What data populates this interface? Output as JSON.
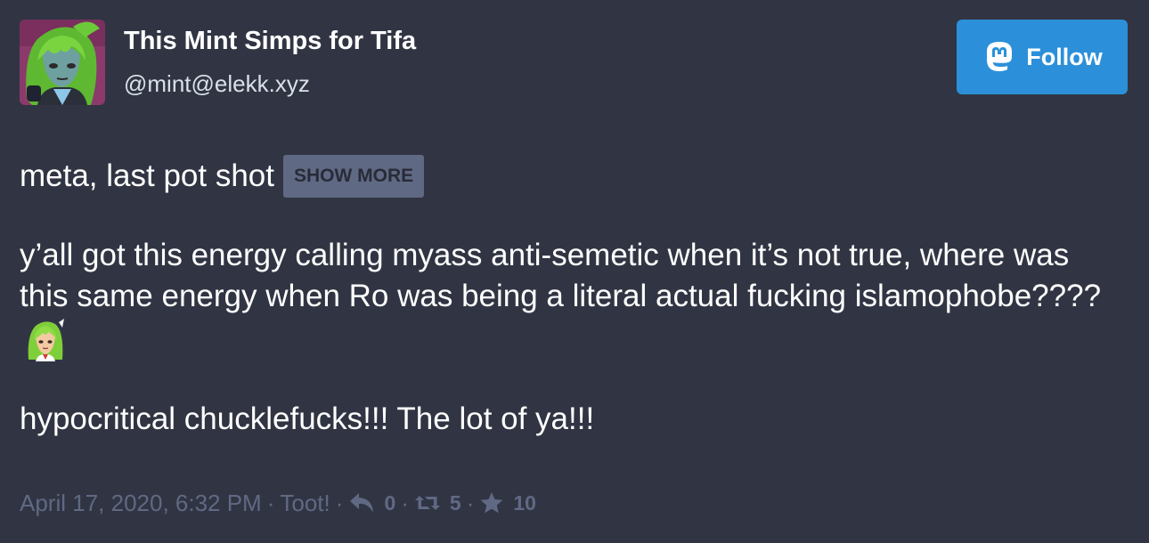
{
  "account": {
    "display_name": "This Mint Simps for Tifa",
    "handle": "@mint@elekk.xyz"
  },
  "follow_button": {
    "label": "Follow"
  },
  "status": {
    "content_warning": "meta, last pot shot",
    "show_more_label": "Show more",
    "paragraphs": [
      "y’all got this energy calling myass anti-semetic when it’s not true, where was this same energy when Ro was being a literal actual fucking islamophobe????",
      "hypocritical chucklefucks!!! The lot of ya!!!"
    ]
  },
  "meta": {
    "timestamp": "April 17, 2020, 6:32 PM",
    "separator": "·",
    "app": "Toot!",
    "replies_count": "0",
    "reblogs_count": "5",
    "favourites_count": "10"
  },
  "colors": {
    "background": "#313543",
    "accent": "#2b90d9",
    "muted": "#606984",
    "secondary_text": "#d9e1e8"
  },
  "icons": {
    "follow": "mastodon-logo-icon",
    "reply": "reply-icon",
    "reblog": "retweet-icon",
    "favourite": "star-icon"
  }
}
